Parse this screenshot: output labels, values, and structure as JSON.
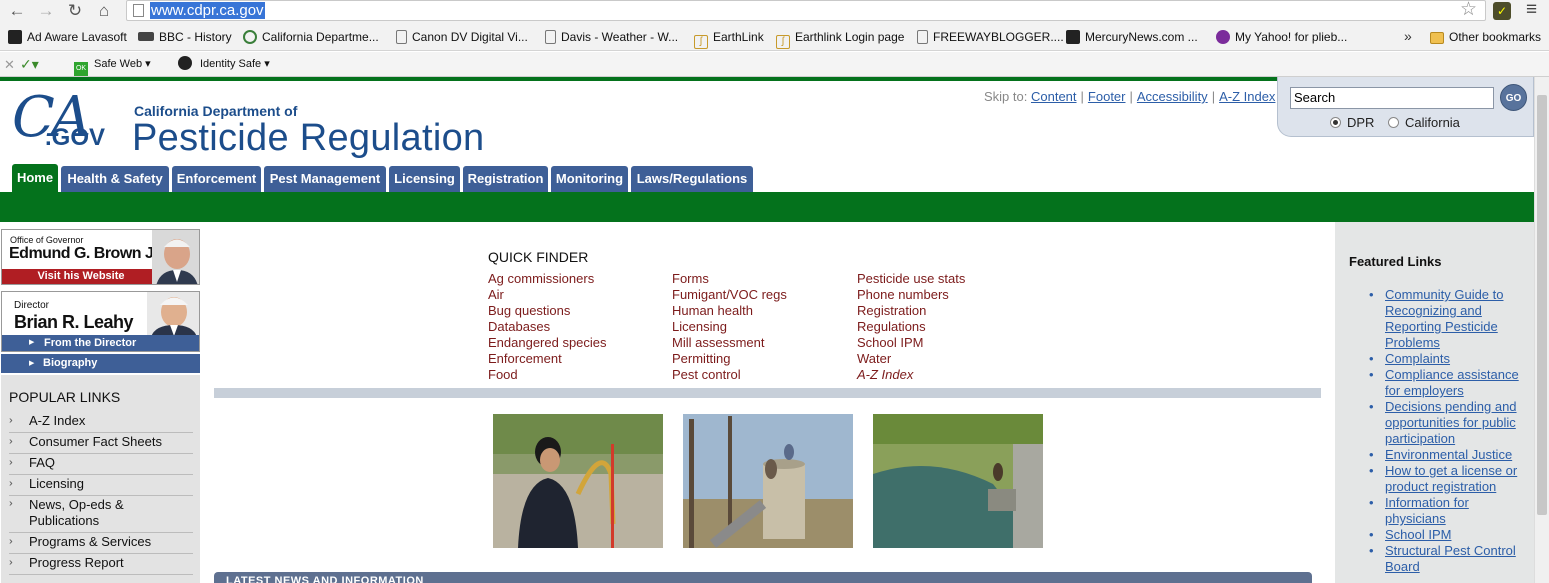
{
  "browser": {
    "url": "www.cdpr.ca.gov",
    "bookmarks": [
      "Ad Aware Lavasoft",
      "BBC - History",
      "California Departme...",
      "Canon DV Digital Vi...",
      "Davis - Weather - W...",
      "EarthLink",
      "Earthlink Login page",
      "FREEWAYBLOGGER....",
      "MercuryNews.com ...",
      "My Yahoo! for plieb..."
    ],
    "other_bookmarks": "Other bookmarks",
    "overflow": "»",
    "toolbar": {
      "safe_web": "Safe Web ▾",
      "identity_safe": "Identity Safe ▾"
    }
  },
  "header": {
    "logo_ca": "CA",
    "logo_gov": ".GOV",
    "logo_subtitle": "California Department of",
    "logo_title": "Pesticide Regulation",
    "skip_to": "Skip to:",
    "skip_links": [
      "Content",
      "Footer",
      "Accessibility",
      "A-Z Index"
    ],
    "search": {
      "value": "Search",
      "go": "GO",
      "options": [
        "DPR",
        "California"
      ],
      "selected": "DPR"
    }
  },
  "tabs": [
    "Home",
    "Health & Safety",
    "Enforcement",
    "Pest Management",
    "Licensing",
    "Registration",
    "Monitoring",
    "Laws/Regulations"
  ],
  "sidebar": {
    "governor": {
      "office": "Office of Governor",
      "name": "Edmund G. Brown Jr.",
      "visit": "Visit his Website"
    },
    "director": {
      "label": "Director",
      "name": "Brian R. Leahy",
      "from": "From the Director",
      "bio": "Biography"
    },
    "popular_title": "POPULAR LINKS",
    "popular_links": [
      "A-Z Index",
      "Consumer Fact Sheets",
      "FAQ",
      "Licensing",
      "News, Op-eds & Publications",
      "Programs & Services",
      "Progress Report"
    ]
  },
  "quick_finder": {
    "title": "QUICK FINDER",
    "col1": [
      "Ag commissioners",
      "Air",
      "Bug questions",
      "Databases",
      "Endangered species",
      "Enforcement",
      "Food"
    ],
    "col2": [
      "Forms",
      "Fumigant/VOC regs",
      "Human health",
      "Licensing",
      "Mill assessment",
      "Permitting",
      "Pest control"
    ],
    "col3": [
      "Pesticide use stats",
      "Phone numbers",
      "Registration",
      "Regulations",
      "School IPM",
      "Water",
      "A-Z Index"
    ]
  },
  "news": {
    "title": "LATEST NEWS AND INFORMATION"
  },
  "featured": {
    "title": "Featured Links",
    "links": [
      "Community Guide to Recognizing and Reporting Pesticide Problems",
      "Complaints",
      "Compliance assistance for employers",
      "Decisions pending and opportunities for public participation",
      "Environmental Justice",
      "How to get a license or product registration",
      "Information for physicians",
      "School IPM",
      "Structural Pest Control Board"
    ]
  },
  "colors": {
    "brand_green": "#04721c",
    "tab_blue": "#3e5f97",
    "link_blue": "#2c5ea8",
    "quickfinder_maroon": "#7c1b1b"
  }
}
